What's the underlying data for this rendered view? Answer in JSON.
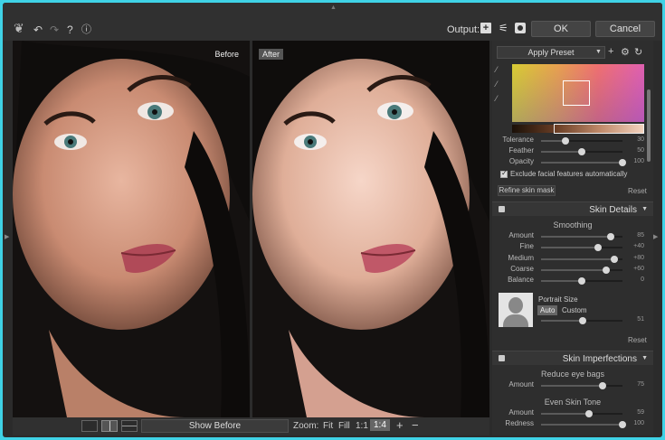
{
  "toolbar": {
    "output_label": "Output:",
    "ok_label": "OK",
    "cancel_label": "Cancel"
  },
  "preview": {
    "before_label": "Before",
    "after_label": "After"
  },
  "bottombar": {
    "show_before_label": "Show Before",
    "zoom_label": "Zoom:",
    "fit_label": "Fit",
    "fill_label": "Fill",
    "z1_label": "1:1",
    "z4_label": "1:4",
    "plus_label": "+",
    "minus_label": "−"
  },
  "panel": {
    "apply_preset_label": "Apply Preset",
    "mask": {
      "tolerance_label": "Tolerance",
      "tolerance_value": "30",
      "feather_label": "Feather",
      "feather_value": "50",
      "opacity_label": "Opacity",
      "opacity_value": "100",
      "exclude_label": "Exclude facial features automatically",
      "exclude_checked": true,
      "refine_label": "Refine skin mask",
      "reset_label": "Reset"
    },
    "skin_details": {
      "title": "Skin Details",
      "smoothing_label": "Smoothing",
      "amount_label": "Amount",
      "amount_value": "85",
      "fine_label": "Fine",
      "fine_value": "+40",
      "medium_label": "Medium",
      "medium_value": "+80",
      "coarse_label": "Coarse",
      "coarse_value": "+60",
      "balance_label": "Balance",
      "balance_value": "0",
      "portrait_size_label": "Portrait Size",
      "auto_label": "Auto",
      "custom_label": "Custom",
      "portrait_value": "51",
      "reset_label": "Reset"
    },
    "skin_imperfections": {
      "title": "Skin Imperfections",
      "eye_bags_label": "Reduce eye bags",
      "eye_amount_label": "Amount",
      "eye_amount_value": "75",
      "even_tone_label": "Even Skin Tone",
      "tone_amount_label": "Amount",
      "tone_amount_value": "59",
      "redness_label": "Redness",
      "redness_value": "100"
    }
  },
  "colors": {
    "background": "#2b2b2b",
    "frame": "#3fd2e6",
    "panel": "#2e2e2e"
  }
}
